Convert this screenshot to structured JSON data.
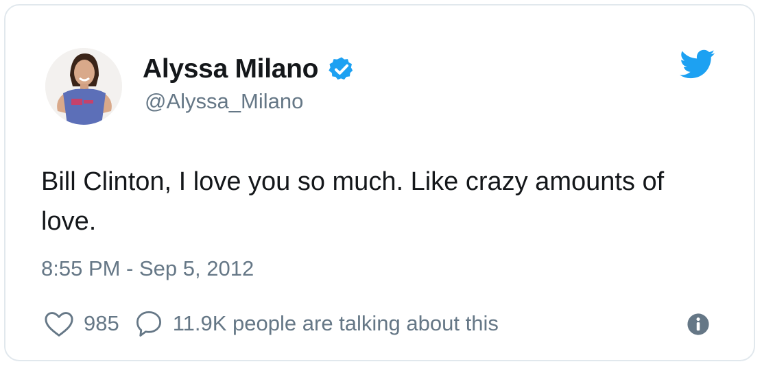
{
  "tweet": {
    "author_name": "Alyssa Milano",
    "handle": "@Alyssa_Milano",
    "text": "Bill Clinton, I love you so much. Like crazy amounts of love.",
    "timestamp": "8:55 PM - Sep 5, 2012",
    "likes": "985",
    "talking": "11.9K people are talking about this",
    "verified": true
  },
  "icons": {
    "avatar": "profile-photo",
    "verified": "verified-badge-icon",
    "brand": "twitter-bird-icon",
    "like": "heart-icon",
    "reply": "speech-bubble-icon",
    "info": "info-icon"
  },
  "colors": {
    "accent": "#1da1f2",
    "text": "#14171a",
    "muted": "#657786",
    "border": "#e1e8ed"
  }
}
